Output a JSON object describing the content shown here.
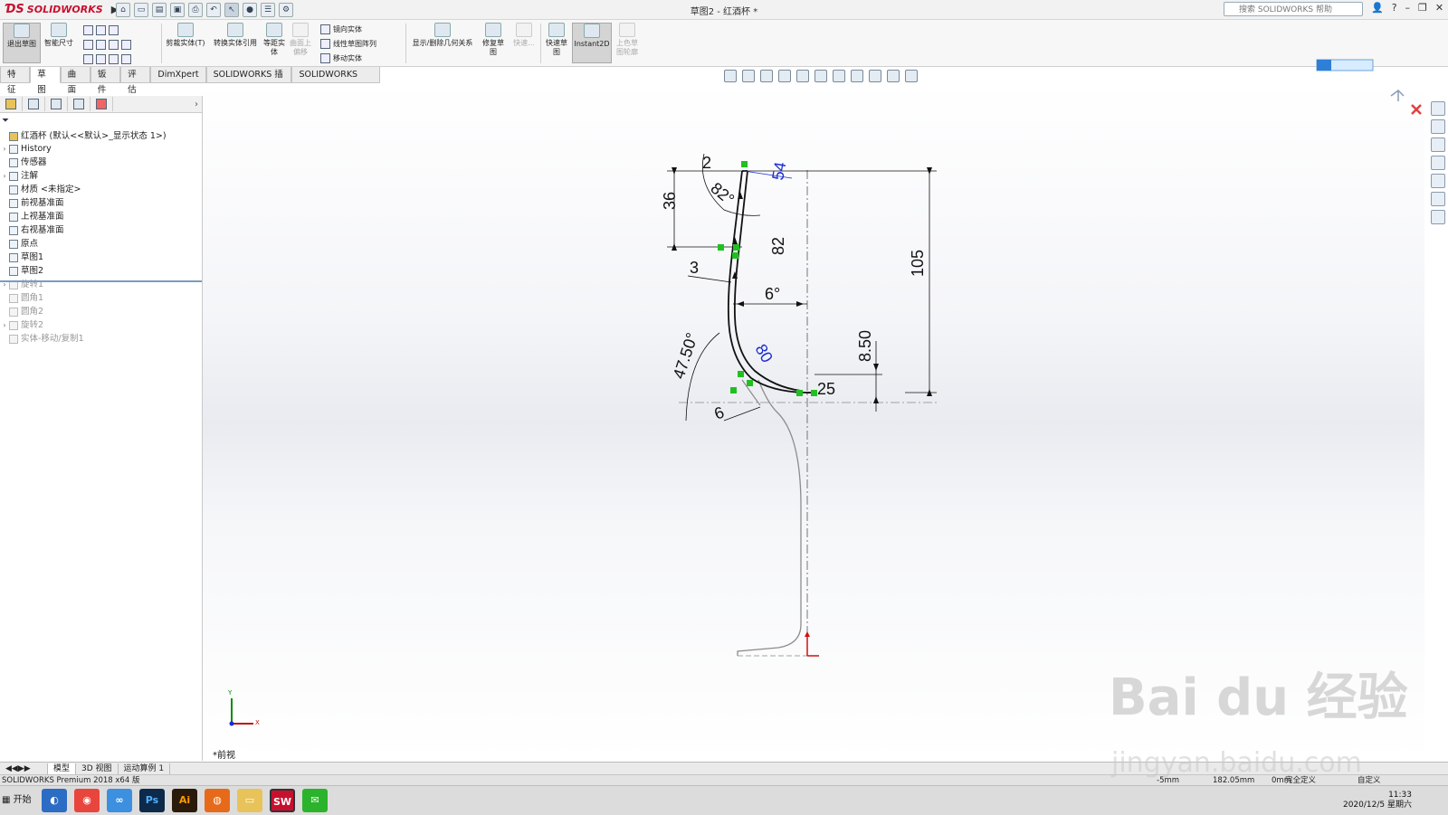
{
  "app": {
    "brand": "SOLIDWORKS",
    "doc_title": "草图2 - 红酒杯 *",
    "help_search_placeholder": "搜索 SOLIDWORKS 帮助"
  },
  "colors": {
    "brand_red": "#c8102e",
    "dimension_black": "#111111",
    "driven_blue": "#1a2bd0",
    "relation_green": "#20c020",
    "origin_red": "#d01010"
  },
  "toolbar": {
    "exit_sketch": "退出草图",
    "smart_dimension": "智能尺寸",
    "trim": "剪裁实体(T)",
    "convert": "转换实体引用",
    "offset": "等距实体",
    "surface_offset": "曲面上偏移",
    "mirror": "镜向实体",
    "linear_pattern": "线性草图阵列",
    "move": "移动实体",
    "show_relations": "显示/删除几何关系",
    "repair": "修复草图",
    "quick_snaps": "快速...",
    "rapid_sketch": "快速草图",
    "instant2d": "Instant2D",
    "shaded_sketch": "上色草图轮廓"
  },
  "command_tabs": [
    "特征",
    "草图",
    "曲面",
    "钣件",
    "评估",
    "DimXpert",
    "SOLIDWORKS 插件",
    "SOLIDWORKS MBD"
  ],
  "command_tab_active": 1,
  "tree": {
    "root": "红酒杯 (默认<<默认>_显示状态 1>)",
    "items": [
      {
        "label": "History",
        "expandable": true,
        "dim": false
      },
      {
        "label": "传感器",
        "expandable": false,
        "dim": false
      },
      {
        "label": "注解",
        "expandable": true,
        "dim": false
      },
      {
        "label": "材质 <未指定>",
        "expandable": false,
        "dim": false
      },
      {
        "label": "前视基准面",
        "expandable": false,
        "dim": false
      },
      {
        "label": "上视基准面",
        "expandable": false,
        "dim": false
      },
      {
        "label": "右视基准面",
        "expandable": false,
        "dim": false
      },
      {
        "label": "原点",
        "expandable": false,
        "dim": false
      },
      {
        "label": "草图1",
        "expandable": false,
        "dim": false
      },
      {
        "label": "草图2",
        "expandable": false,
        "dim": false
      },
      {
        "label": "旋转1",
        "expandable": true,
        "dim": true
      },
      {
        "label": "圆角1",
        "expandable": false,
        "dim": true
      },
      {
        "label": "圆角2",
        "expandable": false,
        "dim": true
      },
      {
        "label": "旋转2",
        "expandable": true,
        "dim": true
      },
      {
        "label": "实体-移动/复制1",
        "expandable": false,
        "dim": true
      }
    ]
  },
  "sketch": {
    "dimensions": [
      "2",
      "82°",
      "54",
      "36",
      "82",
      "3",
      "6°",
      "105",
      "80",
      "8.50",
      "47.50°",
      "25",
      "6"
    ],
    "view_name": "*前视",
    "triad": {
      "x": "X",
      "y": "Y"
    }
  },
  "bottom_tabs": [
    "模型",
    "3D 视图",
    "运动算例 1"
  ],
  "bottom_tab_active": 0,
  "status": {
    "left": "SOLIDWORKS Premium 2018 x64 版",
    "x": "-5mm",
    "y": "182.05mm",
    "z": "0mm",
    "state": "完全定义",
    "units": "自定义"
  },
  "taskbar": {
    "start": "开始",
    "apps": [
      "browser-icon",
      "chrome-icon",
      "baidu-netdisk-icon",
      "Ps",
      "Ai",
      "firefox-icon",
      "folder-icon",
      "SW",
      "wechat-icon"
    ],
    "time": "11:33",
    "date": "2020/12/5 星期六"
  },
  "watermark": {
    "logo": "Bai du 经验",
    "url": "jingyan.baidu.com"
  }
}
